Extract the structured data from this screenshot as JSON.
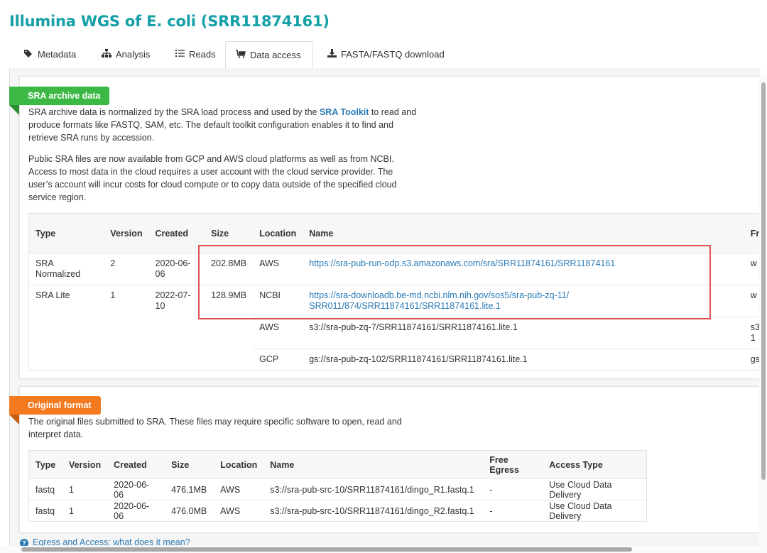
{
  "title": "Illumina WGS of E. coli (SRR11874161)",
  "tabs": [
    {
      "label": "Metadata",
      "icon": "tags-icon"
    },
    {
      "label": "Analysis",
      "icon": "sitemap-icon"
    },
    {
      "label": "Reads",
      "icon": "list-icon"
    },
    {
      "label": "Data access",
      "icon": "cart-icon",
      "active": true
    },
    {
      "label": "FASTA/FASTQ download",
      "icon": "download-icon"
    }
  ],
  "sra": {
    "ribbon": "SRA archive data",
    "ribbon_color": "#3cb944",
    "p1_before": "SRA archive data is normalized by the SRA load process and used by the ",
    "p1_link": "SRA Toolkit",
    "p1_after": " to read and produce formats like FASTQ, SAM, etc. The default toolkit configuration enables it to find and retrieve SRA runs by accession.",
    "p2": "Public SRA files are now available from GCP and AWS cloud platforms as well as from NCBI. Access to most data in the cloud requires a user account with the cloud service provider. The user’s account will incur costs for cloud compute or to copy data outside of the specified cloud service region.",
    "headers": [
      "Type",
      "Version",
      "Created",
      "Size",
      "Location",
      "Name",
      "Fr"
    ],
    "rows": [
      {
        "type": "SRA Normalized",
        "version": "2",
        "created": "2020-06-06",
        "size": "202.8MB",
        "location": "AWS",
        "name": "https://sra-pub-run-odp.s3.amazonaws.com/sra/SRR11874161/SRR11874161",
        "extra": "w"
      },
      {
        "type": "SRA Lite",
        "version": "1",
        "created": "2022-07-10",
        "size": "128.9MB",
        "location": "NCBI",
        "name": "https://sra-downloadb.be-md.ncbi.nlm.nih.gov/sos5/sra-pub-zq-11/SRR011/874/SRR11874161/SRR11874161.lite.1",
        "extra": "w"
      },
      {
        "type": "",
        "version": "",
        "created": "",
        "size": "",
        "location": "AWS",
        "name": "s3://sra-pub-zq-7/SRR11874161/SRR11874161.lite.1",
        "extra": "s3 1"
      },
      {
        "type": "",
        "version": "",
        "created": "",
        "size": "",
        "location": "GCP",
        "name": "gs://sra-pub-zq-102/SRR11874161/SRR11874161.lite.1",
        "extra": "gs"
      }
    ]
  },
  "original": {
    "ribbon": "Original format",
    "ribbon_color": "#f47a20",
    "p1": "The original files submitted to SRA. These files may require specific software to open, read and interpret data.",
    "headers": [
      "Type",
      "Version",
      "Created",
      "Size",
      "Location",
      "Name",
      "Free Egress",
      "Access Type"
    ],
    "rows": [
      [
        "fastq",
        "1",
        "2020-06-06",
        "476.1MB",
        "AWS",
        "s3://sra-pub-src-10/SRR11874161/dingo_R1.fastq.1",
        "-",
        "Use Cloud Data Delivery"
      ],
      [
        "fastq",
        "1",
        "2020-06-06",
        "476.0MB",
        "AWS",
        "s3://sra-pub-src-10/SRR11874161/dingo_R2.fastq.1",
        "-",
        "Use Cloud Data Delivery"
      ]
    ]
  },
  "help_link": "Egress and Access: what does it mean?"
}
